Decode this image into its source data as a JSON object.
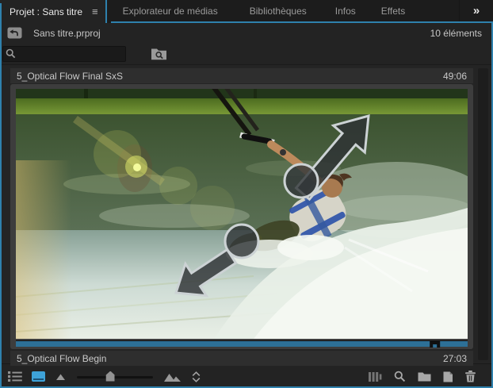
{
  "tabs": [
    {
      "label": "Projet : Sans titre",
      "active": true
    },
    {
      "label": "Explorateur de médias",
      "active": false
    },
    {
      "label": "Bibliothèques",
      "active": false
    },
    {
      "label": "Infos",
      "active": false
    },
    {
      "label": "Effets",
      "active": false
    }
  ],
  "panel_menu_glyph": "≡",
  "tab_overflow_glyph": "»",
  "pathbar": {
    "project_file": "Sans titre.prproj",
    "items_count": "10 éléments"
  },
  "search": {
    "value": "",
    "placeholder": ""
  },
  "items": [
    {
      "name": "5_Optical Flow Final SxS",
      "duration": "49:06"
    },
    {
      "name": "5_Optical Flow Begin",
      "duration": "27:03",
      "selected": true,
      "scrub_position_percent": 93
    }
  ],
  "toolbar": {
    "zoom_slider_percent": 44
  },
  "icons": {
    "navigate_up": "folder-up-icon",
    "search": "magnifier-icon",
    "search_in_bin": "folder-magnifier-icon",
    "list_view": "list-view-icon",
    "icon_view": "icon-view-icon",
    "zoom_out": "small-mountain-icon",
    "zoom_in": "large-mountain-icon",
    "sort": "sort-chevrons-icon",
    "automate_to_sequence": "sequence-bars-icon",
    "find": "find-magnifier-icon",
    "new_bin": "folder-icon",
    "new_item": "new-item-page-icon",
    "delete": "trash-icon"
  },
  "colors": {
    "focus_border": "#2e81ad",
    "active_icon_blue": "#3ea2d8",
    "scrub_bar_blue": "#2d7097",
    "tile_frame_gray": "#3d3d3d",
    "caption_bg": "#2e2e2e"
  }
}
